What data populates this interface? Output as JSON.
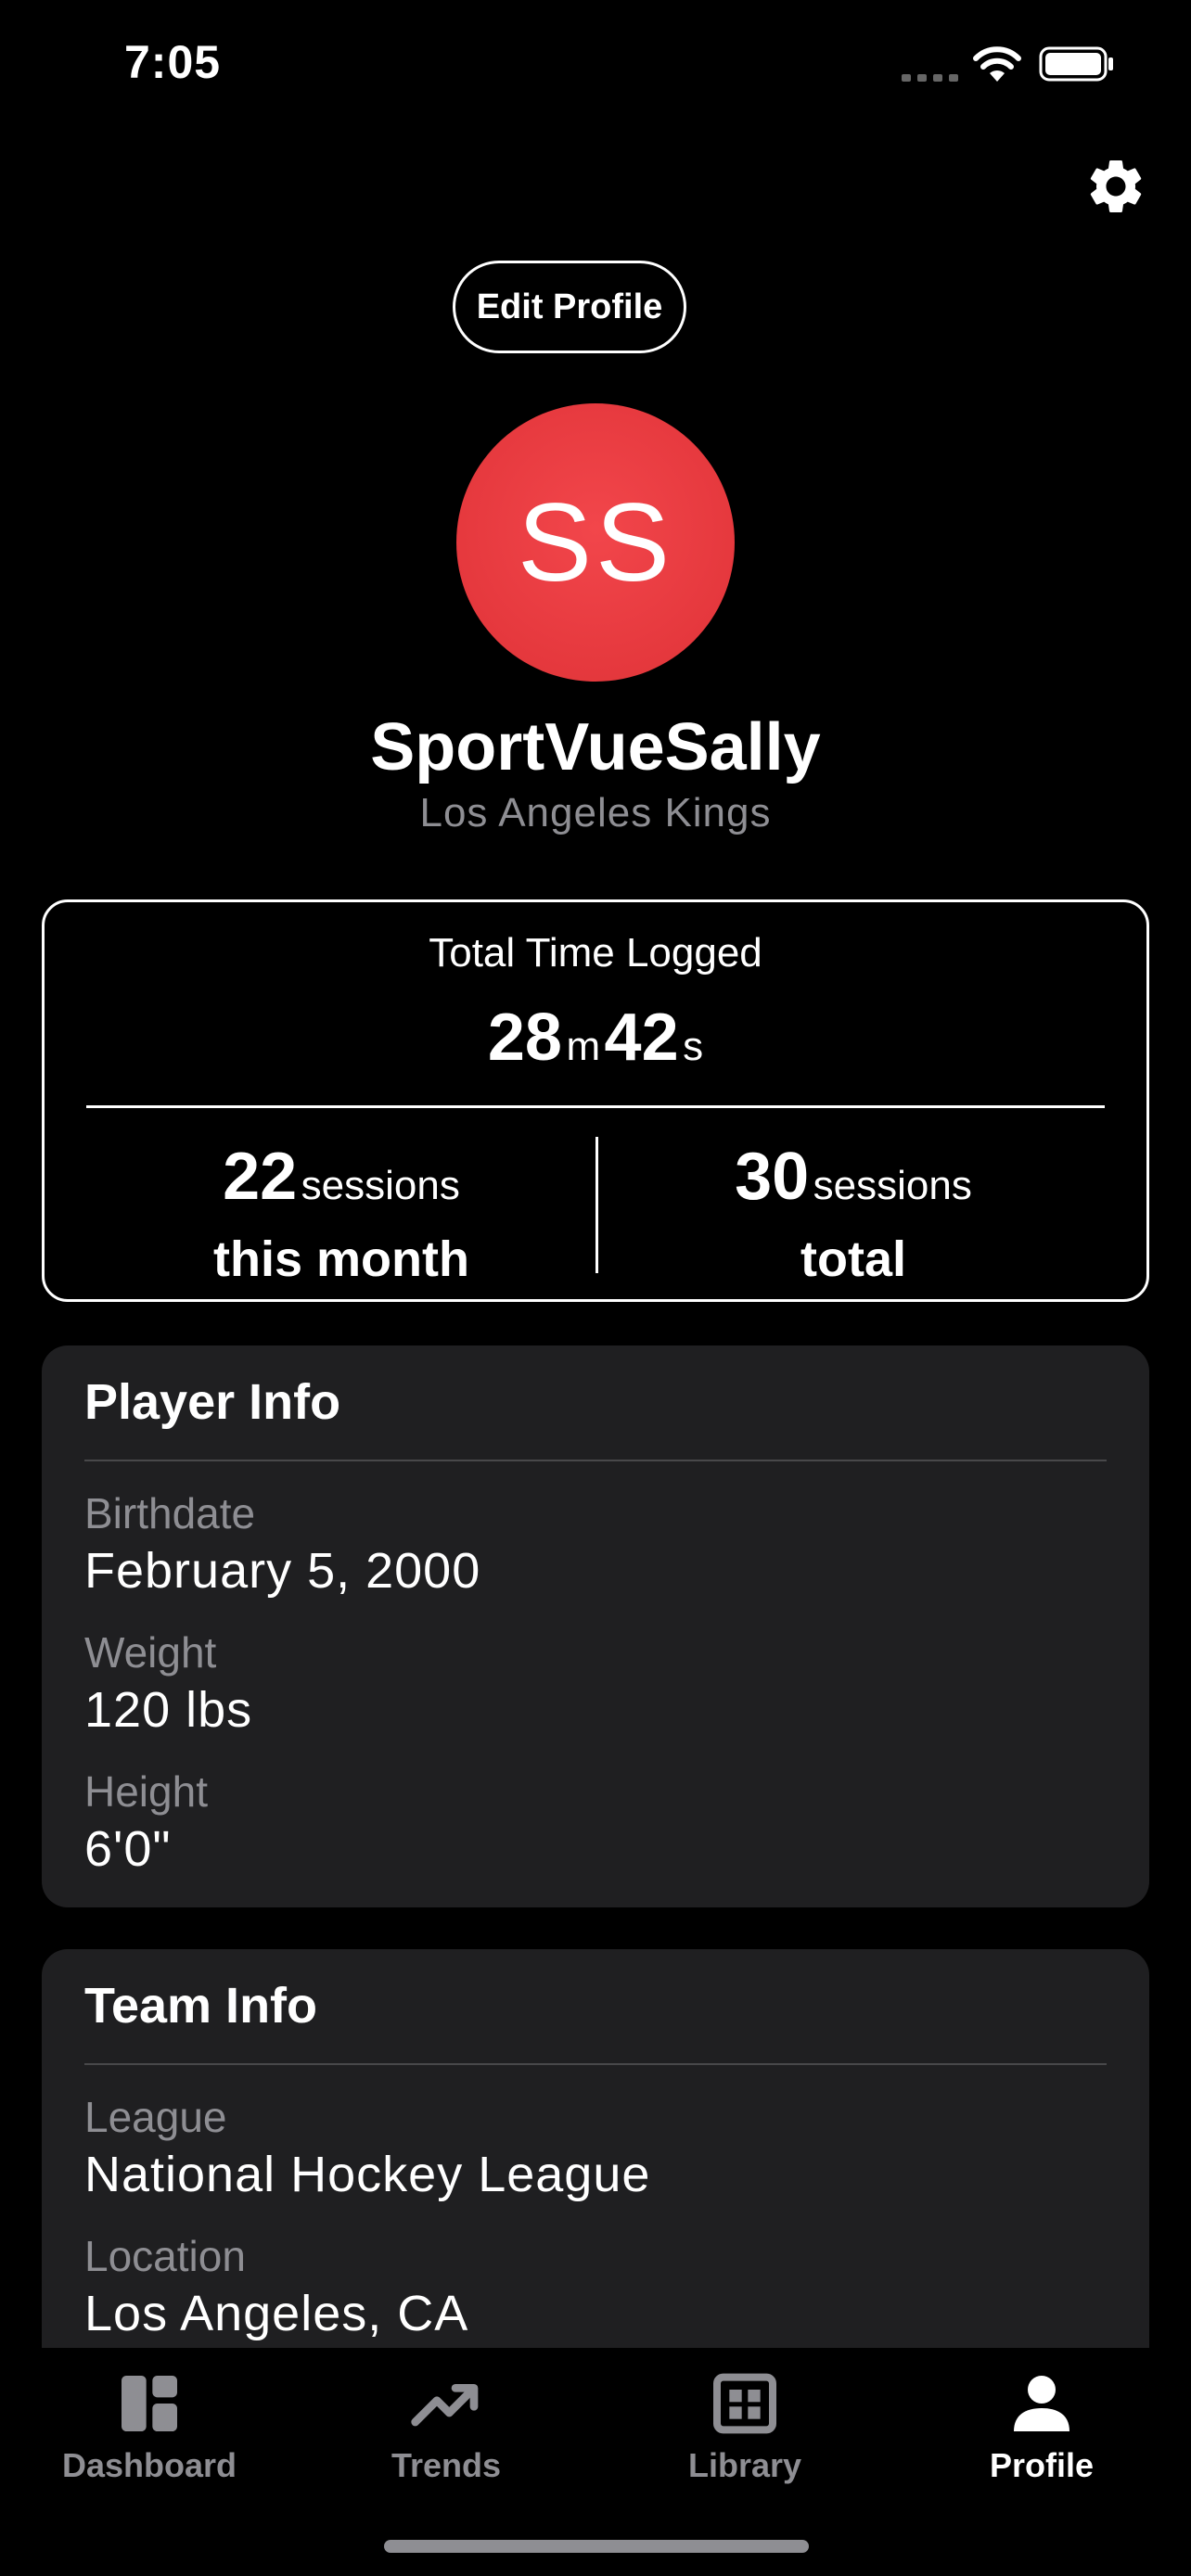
{
  "status_bar": {
    "time": "7:05"
  },
  "header": {
    "edit_profile_label": "Edit Profile",
    "settings_icon": "gear-icon"
  },
  "profile": {
    "initials": "SS",
    "avatar_color": "#e5383d",
    "username": "SportVueSally",
    "team": "Los Angeles Kings"
  },
  "stats": {
    "total_label": "Total Time Logged",
    "minutes": "28",
    "minutes_unit": "m",
    "seconds": "42",
    "seconds_unit": "s",
    "month_count": "22",
    "month_unit": "sessions",
    "month_label": "this month",
    "total_count": "30",
    "total_unit": "sessions",
    "total_label2": "total"
  },
  "player_info": {
    "title": "Player Info",
    "fields": [
      {
        "label": "Birthdate",
        "value": "February 5, 2000"
      },
      {
        "label": "Weight",
        "value": "120 lbs"
      },
      {
        "label": "Height",
        "value": "6'0\""
      }
    ]
  },
  "team_info": {
    "title": "Team Info",
    "fields": [
      {
        "label": "League",
        "value": "National Hockey League"
      },
      {
        "label": "Location",
        "value": "Los Angeles, CA"
      }
    ]
  },
  "tabs": [
    {
      "label": "Dashboard",
      "icon": "dashboard-icon",
      "active": false
    },
    {
      "label": "Trends",
      "icon": "trending-up-icon",
      "active": false
    },
    {
      "label": "Library",
      "icon": "library-grid-icon",
      "active": false
    },
    {
      "label": "Profile",
      "icon": "person-icon",
      "active": true
    }
  ]
}
